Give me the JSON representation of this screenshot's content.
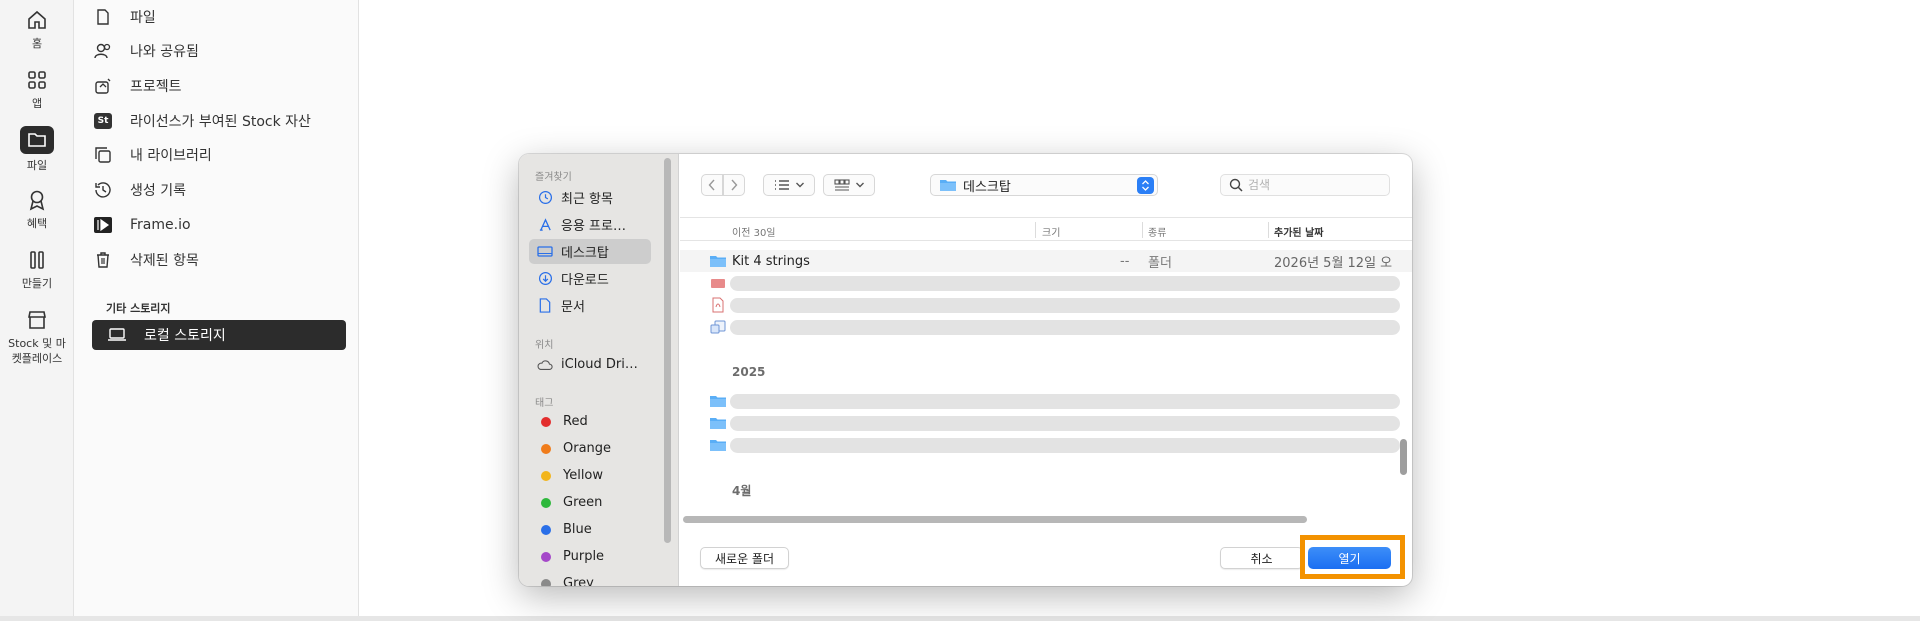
{
  "rail": {
    "items": [
      {
        "label": "홈",
        "icon": "home-icon"
      },
      {
        "label": "앱",
        "icon": "apps-icon"
      },
      {
        "label": "파일",
        "icon": "folder-icon"
      },
      {
        "label": "혜택",
        "icon": "ribbon-icon"
      },
      {
        "label": "만들기",
        "icon": "tools-icon"
      },
      {
        "label": "Stock 및 마켓플레이스",
        "label_line1": "Stock 및 마",
        "label_line2": "켓플레이스",
        "icon": "store-icon"
      }
    ]
  },
  "sidebar": {
    "items": [
      {
        "label": "파일",
        "icon": "document-icon"
      },
      {
        "label": "나와 공유됨",
        "icon": "people-icon"
      },
      {
        "label": "프로젝트",
        "icon": "projects-icon"
      },
      {
        "label": "라이선스가 부여된 Stock 자산",
        "icon": "stock-icon",
        "badge": "St"
      },
      {
        "label": "내 라이브러리",
        "icon": "library-icon"
      },
      {
        "label": "생성 기록",
        "icon": "history-icon"
      },
      {
        "label": "Frame.io",
        "icon": "frameio-icon"
      },
      {
        "label": "삭제된 항목",
        "icon": "trash-icon"
      }
    ],
    "section_title": "기타 스토리지",
    "active_item": {
      "label": "로컬 스토리지",
      "icon": "laptop-icon"
    }
  },
  "dialog": {
    "sidebar": {
      "favorites_title": "즐겨찾기",
      "favorites": [
        {
          "label": "최근 항목",
          "icon": "clock-icon"
        },
        {
          "label": "응용 프로…",
          "icon": "appstore-icon"
        },
        {
          "label": "데스크탑",
          "icon": "desktop-icon",
          "selected": true
        },
        {
          "label": "다운로드",
          "icon": "download-icon"
        },
        {
          "label": "문서",
          "icon": "doc-icon"
        }
      ],
      "locations_title": "위치",
      "locations": [
        {
          "label": "iCloud Dri…",
          "icon": "cloud-icon"
        }
      ],
      "tags_title": "태그",
      "tags": [
        {
          "label": "Red",
          "color": "#e32d2d"
        },
        {
          "label": "Orange",
          "color": "#f07c1b"
        },
        {
          "label": "Yellow",
          "color": "#f2b51c"
        },
        {
          "label": "Green",
          "color": "#2eb83c"
        },
        {
          "label": "Blue",
          "color": "#2a6fe8"
        },
        {
          "label": "Purple",
          "color": "#a548c9"
        },
        {
          "label": "Grey",
          "color": "#8a8a8a"
        }
      ]
    },
    "toolbar": {
      "location": "데스크탑",
      "search_placeholder": "검색"
    },
    "columns": {
      "name": "이전 30일",
      "size": "크기",
      "kind": "종류",
      "date_added": "추가된 날짜"
    },
    "rows": [
      {
        "name": "Kit 4 strings",
        "size": "--",
        "kind": "폴더",
        "date_added": "2026년 5월 12일 오"
      }
    ],
    "groups": {
      "year": "2025",
      "month": "4월"
    },
    "buttons": {
      "new_folder": "새로운 폴더",
      "cancel": "취소",
      "open": "열기"
    },
    "highlight_color": "#f39200"
  }
}
